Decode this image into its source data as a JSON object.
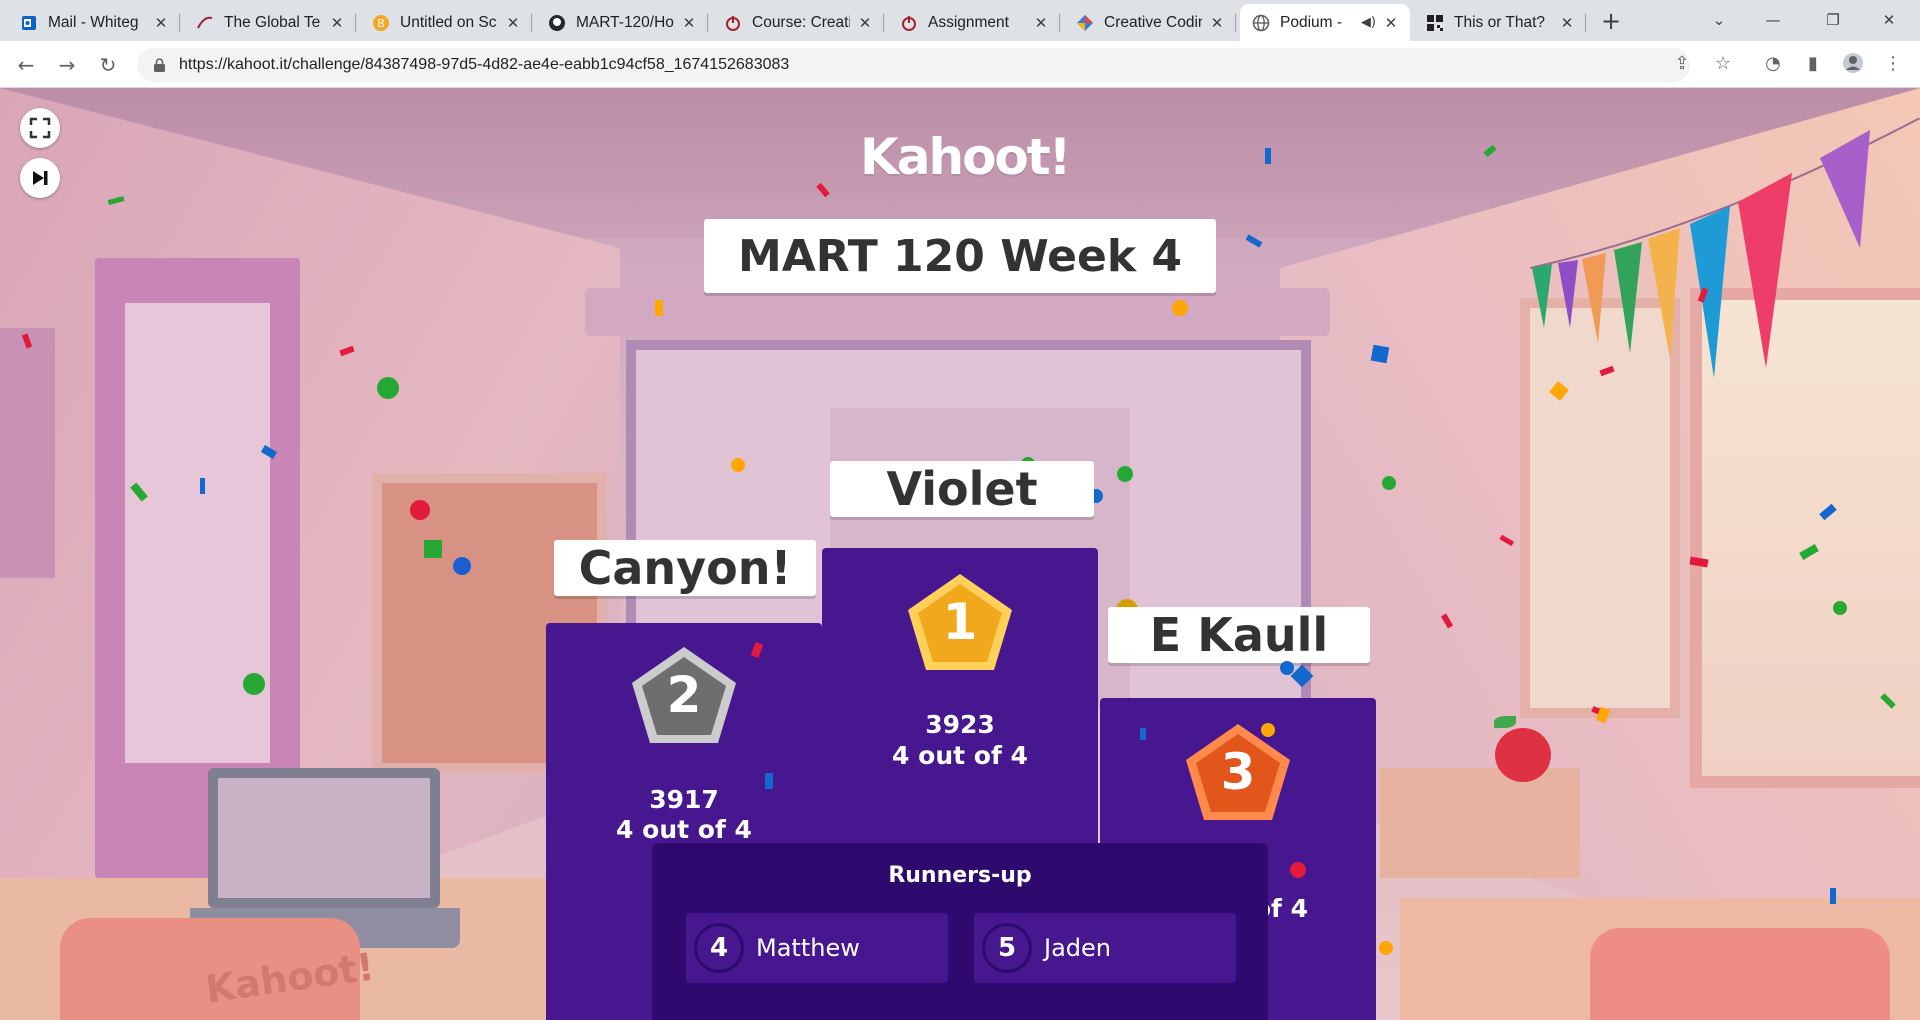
{
  "tabs": [
    {
      "title": "Mail - Whiteg",
      "icon": "outlook-icon"
    },
    {
      "title": "The Global Te",
      "icon": "swoosh-icon"
    },
    {
      "title": "Untitled on Sc",
      "icon": "bitcoin-icon"
    },
    {
      "title": "MART-120/Ho",
      "icon": "github-icon"
    },
    {
      "title": "Course: Creati",
      "icon": "power-icon"
    },
    {
      "title": "Assignment",
      "icon": "power-icon"
    },
    {
      "title": "Creative Codir",
      "icon": "diamond-icon"
    },
    {
      "title": "Podium -",
      "icon": "globe-icon",
      "active": true,
      "audio": true
    },
    {
      "title": "This or That?",
      "icon": "qr-icon"
    }
  ],
  "address_bar": {
    "url": "https://kahoot.it/challenge/84387498-97d5-4d82-ae4e-eabb1c94cf58_1674152683083"
  },
  "page": {
    "logo_text": "Kahoot!",
    "quiz_title": "MART 120 Week 4",
    "podium": {
      "first": {
        "rank": "1",
        "name": "Violet",
        "score": "3923",
        "correct": "4 out of 4",
        "medal_color": "#f2a81d"
      },
      "second": {
        "rank": "2",
        "name": "Canyon!",
        "score": "3917",
        "correct": "4 out of 4",
        "medal_color": "#6e6e6e"
      },
      "third": {
        "rank": "3",
        "name": "E Kaull",
        "score": "",
        "correct": "of 4",
        "medal_color": "#e2561b"
      }
    },
    "runners_up": {
      "title": "Runners-up",
      "items": [
        {
          "rank": "4",
          "name": "Matthew"
        },
        {
          "rank": "5",
          "name": "Jaden"
        }
      ]
    },
    "chair_text": "Kahoot!"
  },
  "colors": {
    "podium": "#46178f",
    "runners_panel": "#2e0a6e"
  }
}
